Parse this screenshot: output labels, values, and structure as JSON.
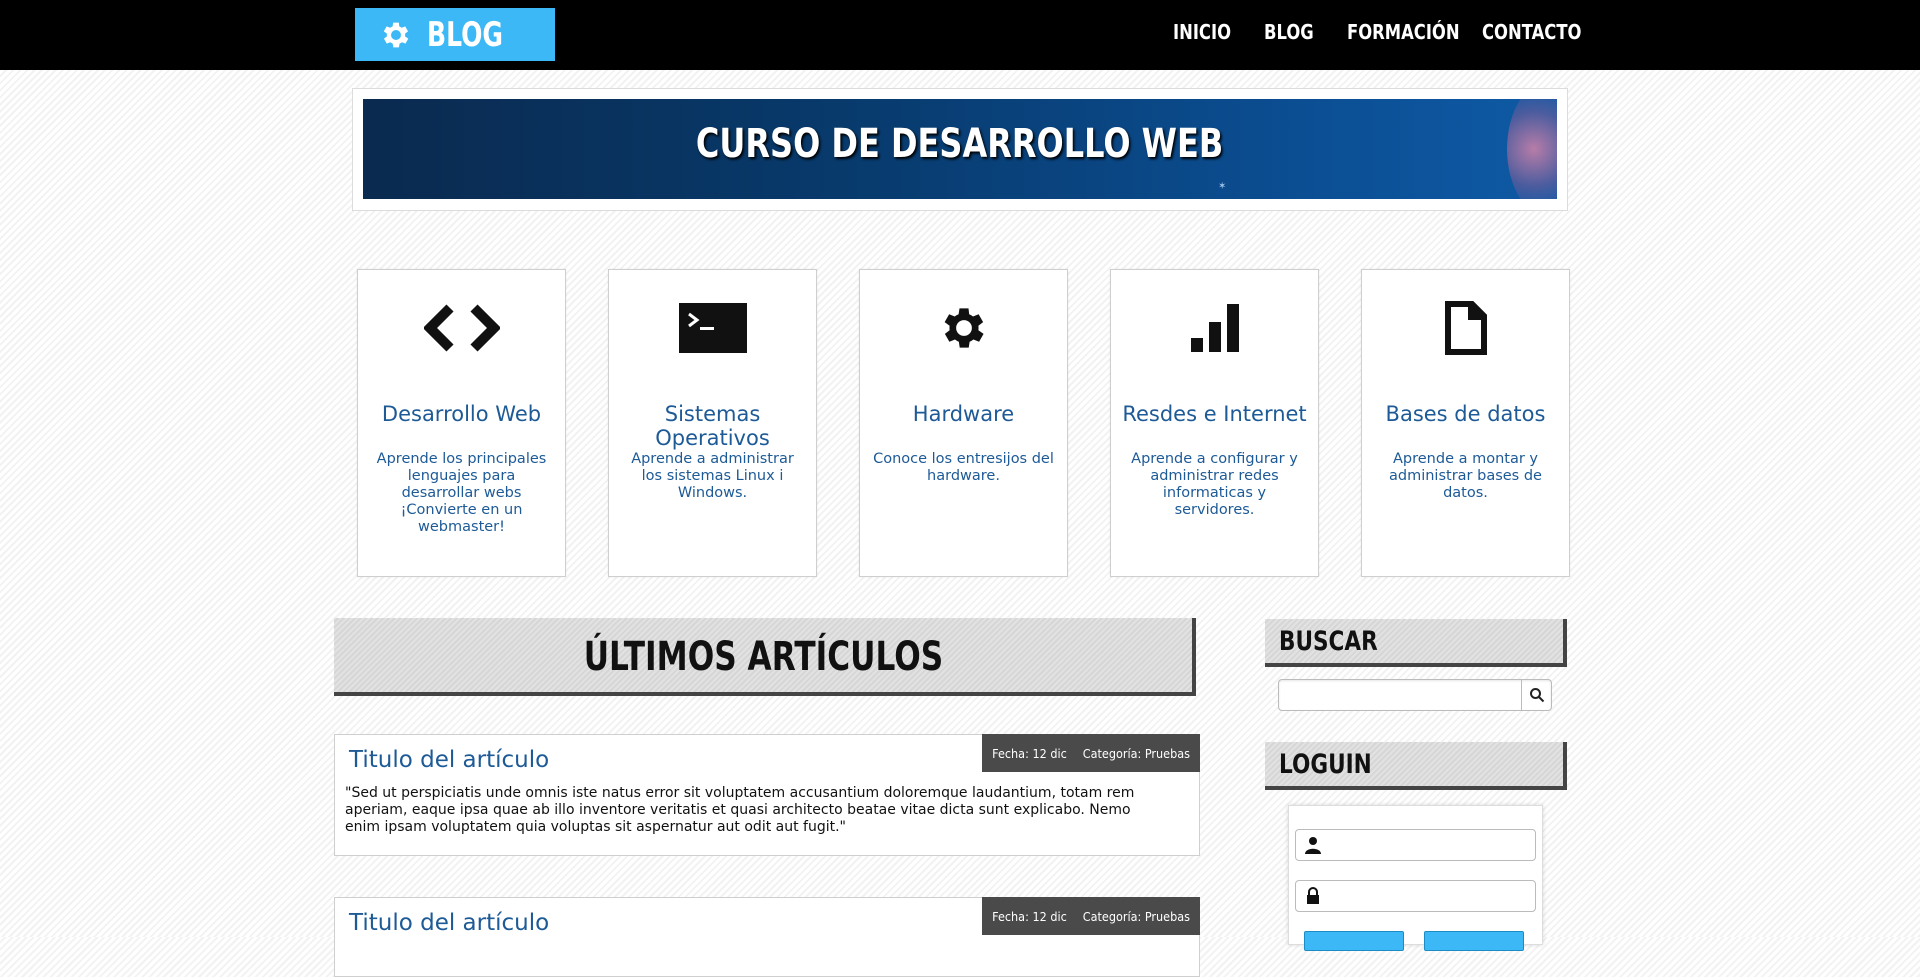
{
  "header": {
    "logo_text": "BLOG",
    "nav": [
      "INICIO",
      "BLOG",
      "FORMACIÓN",
      "CONTACTO"
    ]
  },
  "banner": {
    "title": "CURSO DE DESARROLLO WEB"
  },
  "categories": [
    {
      "icon": "code-icon",
      "title": "Desarrollo Web",
      "description": "Aprende los principales lenguajes para desarrollar webs ¡Convierte en un webmaster!"
    },
    {
      "icon": "terminal-icon",
      "title": "Sistemas Operativos",
      "description": "Aprende a administrar los sistemas Linux i Windows."
    },
    {
      "icon": "gear-icon",
      "title": "Hardware",
      "description": "Conoce los entresijos del hardware."
    },
    {
      "icon": "signal-bars-icon",
      "title": "Resdes e Internet",
      "description": "Aprende a configurar y administrar redes informaticas y servidores."
    },
    {
      "icon": "document-icon",
      "title": "Bases de datos",
      "description": "Aprende a montar y administrar bases de datos."
    }
  ],
  "articles_section": {
    "title": "ÚLTIMOS ARTÍCULOS"
  },
  "articles": [
    {
      "title": "Titulo del artículo",
      "date_label": "Fecha:",
      "date": "12 dic",
      "category_label": "Categoría:",
      "category": "Pruebas",
      "body": "\"Sed ut perspiciatis unde omnis iste natus error sit voluptatem accusantium doloremque laudantium, totam rem aperiam, eaque ipsa quae ab illo inventore veritatis et quasi architecto beatae vitae dicta sunt explicabo. Nemo enim ipsam voluptatem quia voluptas sit aspernatur aut odit aut fugit.\""
    },
    {
      "title": "Titulo del artículo",
      "date_label": "Fecha:",
      "date": "12 dic",
      "category_label": "Categoría:",
      "category": "Pruebas",
      "body": ""
    }
  ],
  "sidebar": {
    "search_title": "BUSCAR",
    "search_value": "",
    "login_title": "LOGUIN",
    "username_value": "",
    "password_value": ""
  },
  "colors": {
    "accent": "#3bb8f5",
    "link": "#1d5a96",
    "topbar": "#000000"
  }
}
